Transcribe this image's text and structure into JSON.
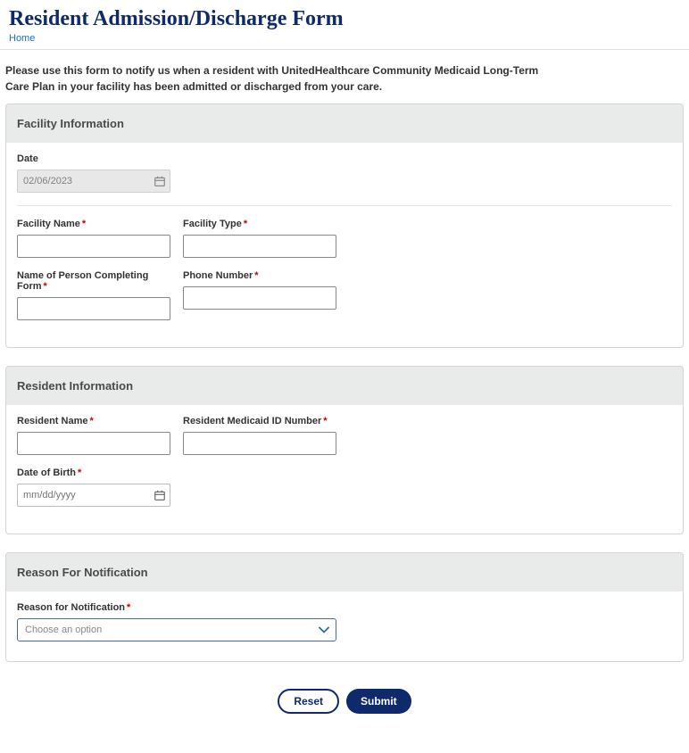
{
  "header": {
    "title": "Resident Admission/Discharge Form",
    "breadcrumb": "Home"
  },
  "intro": "Please use this form to notify us when a resident with UnitedHealthcare Community Medicaid Long-Term Care Plan in your facility has been admitted or discharged from your care.",
  "sections": {
    "facility": {
      "title": "Facility Information",
      "date_label": "Date",
      "date_value": "02/06/2023",
      "facility_name_label": "Facility Name",
      "facility_type_label": "Facility Type",
      "person_label": "Name of Person Completing Form",
      "phone_label": "Phone Number"
    },
    "resident": {
      "title": "Resident Information",
      "name_label": "Resident Name",
      "medicaid_label": "Resident Medicaid ID Number",
      "dob_label": "Date of Birth",
      "dob_placeholder": "mm/dd/yyyy"
    },
    "reason": {
      "title": "Reason For Notification",
      "label": "Reason for Notification",
      "select_placeholder": "Choose an option"
    }
  },
  "buttons": {
    "reset": "Reset",
    "submit": "Submit"
  }
}
